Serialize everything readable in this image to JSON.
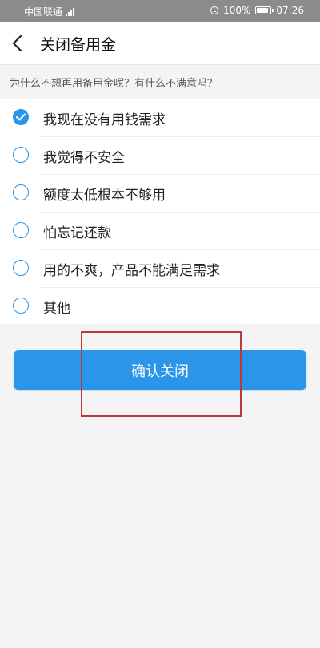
{
  "status_bar": {
    "carrier": "中国联通",
    "network_badge": "4G",
    "battery": "100%",
    "battery_level": 1.0,
    "time": "07:26",
    "icons": [
      "signal-icon",
      "alarm-icon",
      "battery-icon"
    ]
  },
  "nav": {
    "back_icon": "chevron-left-icon",
    "title": "关闭备用金"
  },
  "question": "为什么不想再用备用金呢？有什么不满意吗？",
  "options": [
    {
      "label": "我现在没有用钱需求",
      "checked": true
    },
    {
      "label": "我觉得不安全",
      "checked": false
    },
    {
      "label": "额度太低根本不够用",
      "checked": false
    },
    {
      "label": "怕忘记还款",
      "checked": false
    },
    {
      "label": "用的不爽，产品不能满足需求",
      "checked": false
    },
    {
      "label": "其他",
      "checked": false
    }
  ],
  "confirm_button": "确认关闭",
  "colors": {
    "accent": "#2b95e9",
    "status_bar": "#8b8b8b",
    "highlight": "#b83a3f",
    "background": "#f4f4f4"
  }
}
